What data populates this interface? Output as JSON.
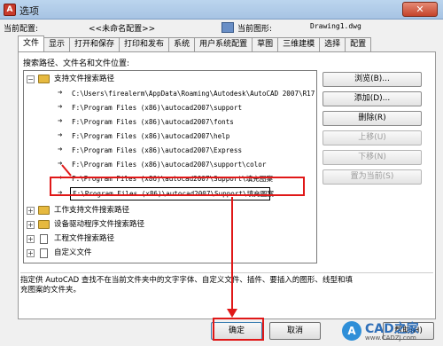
{
  "window": {
    "title": "选项",
    "close_label": "✕"
  },
  "header": {
    "profile_label": "当前配置:",
    "profile_value": "<<未命名配置>>",
    "drawing_label": "当前图形:",
    "drawing_value": "Drawing1.dwg"
  },
  "tabs": [
    "文件",
    "显示",
    "打开和保存",
    "打印和发布",
    "系统",
    "用户系统配置",
    "草图",
    "三维建模",
    "选择",
    "配置"
  ],
  "active_tab": "文件",
  "panel": {
    "label": "搜索路径、文件名和文件位置:"
  },
  "tree": {
    "support_root": "支持文件搜索路径",
    "support_paths": [
      "C:\\Users\\firealerm\\AppData\\Roaming\\Autodesk\\AutoCAD 2007\\R17",
      "F:\\Program Files (x86)\\autocad2007\\support",
      "F:\\Program Files (x86)\\autocad2007\\fonts",
      "F:\\Program Files (x86)\\autocad2007\\help",
      "F:\\Program Files (x86)\\autocad2007\\Express",
      "F:\\Program Files (x86)\\autocad2007\\support\\color",
      "F:\\Program Files (x86)\\autocad2007\\Support\\填充图案"
    ],
    "editing_path": "F:\\Program Files (x86)\\autocad2007\\Support\\填充图案",
    "other_nodes": [
      "工作支持文件搜索路径",
      "设备驱动程序文件搜索路径",
      "工程文件搜索路径",
      "自定义文件"
    ]
  },
  "side_buttons": {
    "browse": "浏览(B)...",
    "add": "添加(D)...",
    "remove": "删除(R)",
    "move_up": "上移(U)",
    "move_down": "下移(N)",
    "set_current": "置为当前(S)"
  },
  "description": "指定供 AutoCAD 查找不在当前文件夹中的文字字体、自定义文件、插件、要插入的图形、线型和填充图案的文件夹。",
  "bottom_buttons": {
    "ok": "确定",
    "cancel": "取消",
    "help": "帮助(H)"
  },
  "watermark": {
    "brand": "CAD之家",
    "url": "www.CADZJ.com"
  },
  "colors": {
    "highlight": "#e01818",
    "title_bar": "#bcd5ee",
    "close_button": "#c5432b"
  }
}
